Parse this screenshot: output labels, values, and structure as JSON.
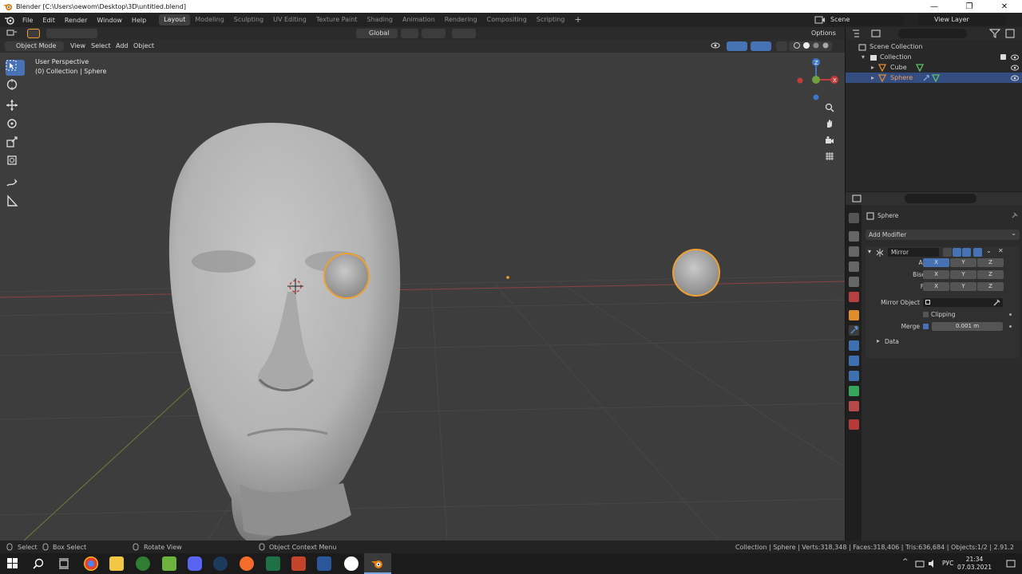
{
  "window": {
    "title": "Blender [C:\\Users\\oewom\\Desktop\\3D\\untitled.blend]",
    "buttons": [
      "—",
      "❐",
      "✕"
    ]
  },
  "menu": [
    "File",
    "Edit",
    "Render",
    "Window",
    "Help"
  ],
  "workspaces": [
    "Layout",
    "Modeling",
    "Sculpting",
    "UV Editing",
    "Texture Paint",
    "Shading",
    "Animation",
    "Rendering",
    "Compositing",
    "Scripting",
    "+"
  ],
  "active_workspace": "Layout",
  "scene": {
    "name": "Scene",
    "view_layer": "View Layer"
  },
  "toolrow": {
    "orientation": "Global",
    "options": "Options"
  },
  "viewheader": {
    "mode": "Object Mode",
    "menus": [
      "View",
      "Select",
      "Add",
      "Object"
    ]
  },
  "viewport": {
    "overlay_line1": "User Perspective",
    "overlay_line2": "(0) Collection | Sphere"
  },
  "outliner": {
    "root": "Scene Collection",
    "collection": "Collection",
    "objects": [
      "Cube",
      "Sphere"
    ],
    "selected": "Sphere"
  },
  "properties": {
    "object_name": "Sphere",
    "add_modifier": "Add Modifier",
    "modifier_name": "Mirror",
    "rows": [
      {
        "label": "Axis",
        "values": [
          "X",
          "Y",
          "Z"
        ],
        "active": [
          true,
          false,
          false
        ]
      },
      {
        "label": "Bisect",
        "values": [
          "X",
          "Y",
          "Z"
        ],
        "active": [
          false,
          false,
          false
        ]
      },
      {
        "label": "Flip",
        "values": [
          "X",
          "Y",
          "Z"
        ],
        "active": [
          false,
          false,
          false
        ]
      }
    ],
    "mirror_object_label": "Mirror Object",
    "clipping_label": "Clipping",
    "merge_label": "Merge",
    "merge_value": "0.001 m",
    "data_label": "Data"
  },
  "statusbar": {
    "select": "Select",
    "box_select": "Box Select",
    "rotate_view": "Rotate View",
    "context_menu": "Object Context Menu",
    "stats": "Collection | Sphere | Verts:318,348 | Faces:318,406 | Tris:636,684 | Objects:1/2 | 2.91.2"
  },
  "taskbar": {
    "language": "РУС",
    "time": "21:34",
    "date": "07.03.2021"
  },
  "colors": {
    "accent": "#4772b3",
    "selection_outline": "#f0a030",
    "viewport_bg": "#3d3d3d"
  }
}
